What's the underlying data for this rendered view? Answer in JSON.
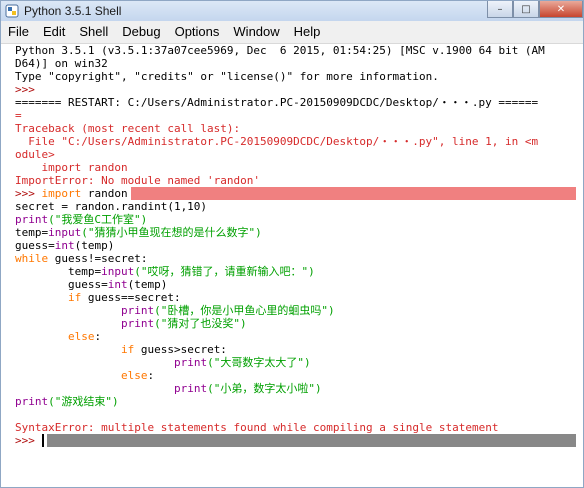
{
  "window": {
    "title": "Python 3.5.1 Shell",
    "controls": {
      "minimize": "–",
      "maximize": "□",
      "close": "✕"
    }
  },
  "menu": [
    "File",
    "Edit",
    "Shell",
    "Debug",
    "Options",
    "Window",
    "Help"
  ],
  "shell": {
    "banner1": "Python 3.5.1 (v3.5.1:37a07cee5969, Dec  6 2015, 01:54:25) [MSC v.1900 64 bit (AM",
    "banner2": "D64)] on win32",
    "banner3": "Type \"copyright\", \"credits\" or \"license()\" for more information.",
    "prompt": ">>> ",
    "restart1": "======= RESTART: C:/Users/Administrator.PC-20150909DCDC/Desktop/・・・.py ======",
    "restart2": "=",
    "tb1": "Traceback (most recent call last):",
    "tb2": "  File \"C:/Users/Administrator.PC-20150909DCDC/Desktop/・・・.py\", line 1, in <m",
    "tb3": "odule>",
    "tb4": "    import randon",
    "tb5": "ImportError: No module named 'randon'",
    "code": {
      "l1_kw": "import",
      "l1_rest": " randon",
      "l2": "secret = randon.randint(1,10)",
      "l3_fn": "print",
      "l3_str": "(\"我爱鱼C工作室\")",
      "l4_a": "temp=",
      "l4_fn": "input",
      "l4_str": "(\"猜猜小甲鱼现在想的是什么数字\")",
      "l5_a": "guess=",
      "l5_fn": "int",
      "l5_b": "(temp)",
      "l6_kw": "while",
      "l6_rest": " guess!=secret:",
      "l7_a": "        temp=",
      "l7_fn": "input",
      "l7_str": "(\"哎呀，猜错了，请重新输入吧：\")",
      "l8_a": "        guess=",
      "l8_fn": "int",
      "l8_b": "(temp)",
      "l9_ind": "        ",
      "l9_kw": "if",
      "l9_rest": " guess==secret:",
      "l10_ind": "                ",
      "l10_fn": "print",
      "l10_str": "(\"卧槽，你是小甲鱼心里的蛔虫吗\")",
      "l11_ind": "                ",
      "l11_fn": "print",
      "l11_str": "(\"猜对了也没奖\")",
      "l12_ind": "        ",
      "l12_kw": "else",
      "l12_rest": ":",
      "l13_ind": "                ",
      "l13_kw": "if",
      "l13_rest": " guess>secret:",
      "l14_ind": "                        ",
      "l14_fn": "print",
      "l14_str": "(\"大哥数字太大了\")",
      "l15_ind": "                ",
      "l15_kw": "else",
      "l15_rest": ":",
      "l16_ind": "                        ",
      "l16_fn": "print",
      "l16_str": "(\"小弟，数字太小啦\")",
      "l17_fn": "print",
      "l17_str": "(\"游戏结束\")"
    },
    "syntax_error": "SyntaxError: multiple statements found while compiling a single statement"
  },
  "colors": {
    "keyword": "#ff7700",
    "builtin": "#900090",
    "string": "#00a000",
    "error": "#d62a2a",
    "highlight_error": "#f08080",
    "highlight_current": "#888888"
  },
  "icons": {
    "app": "python-idle-icon"
  }
}
